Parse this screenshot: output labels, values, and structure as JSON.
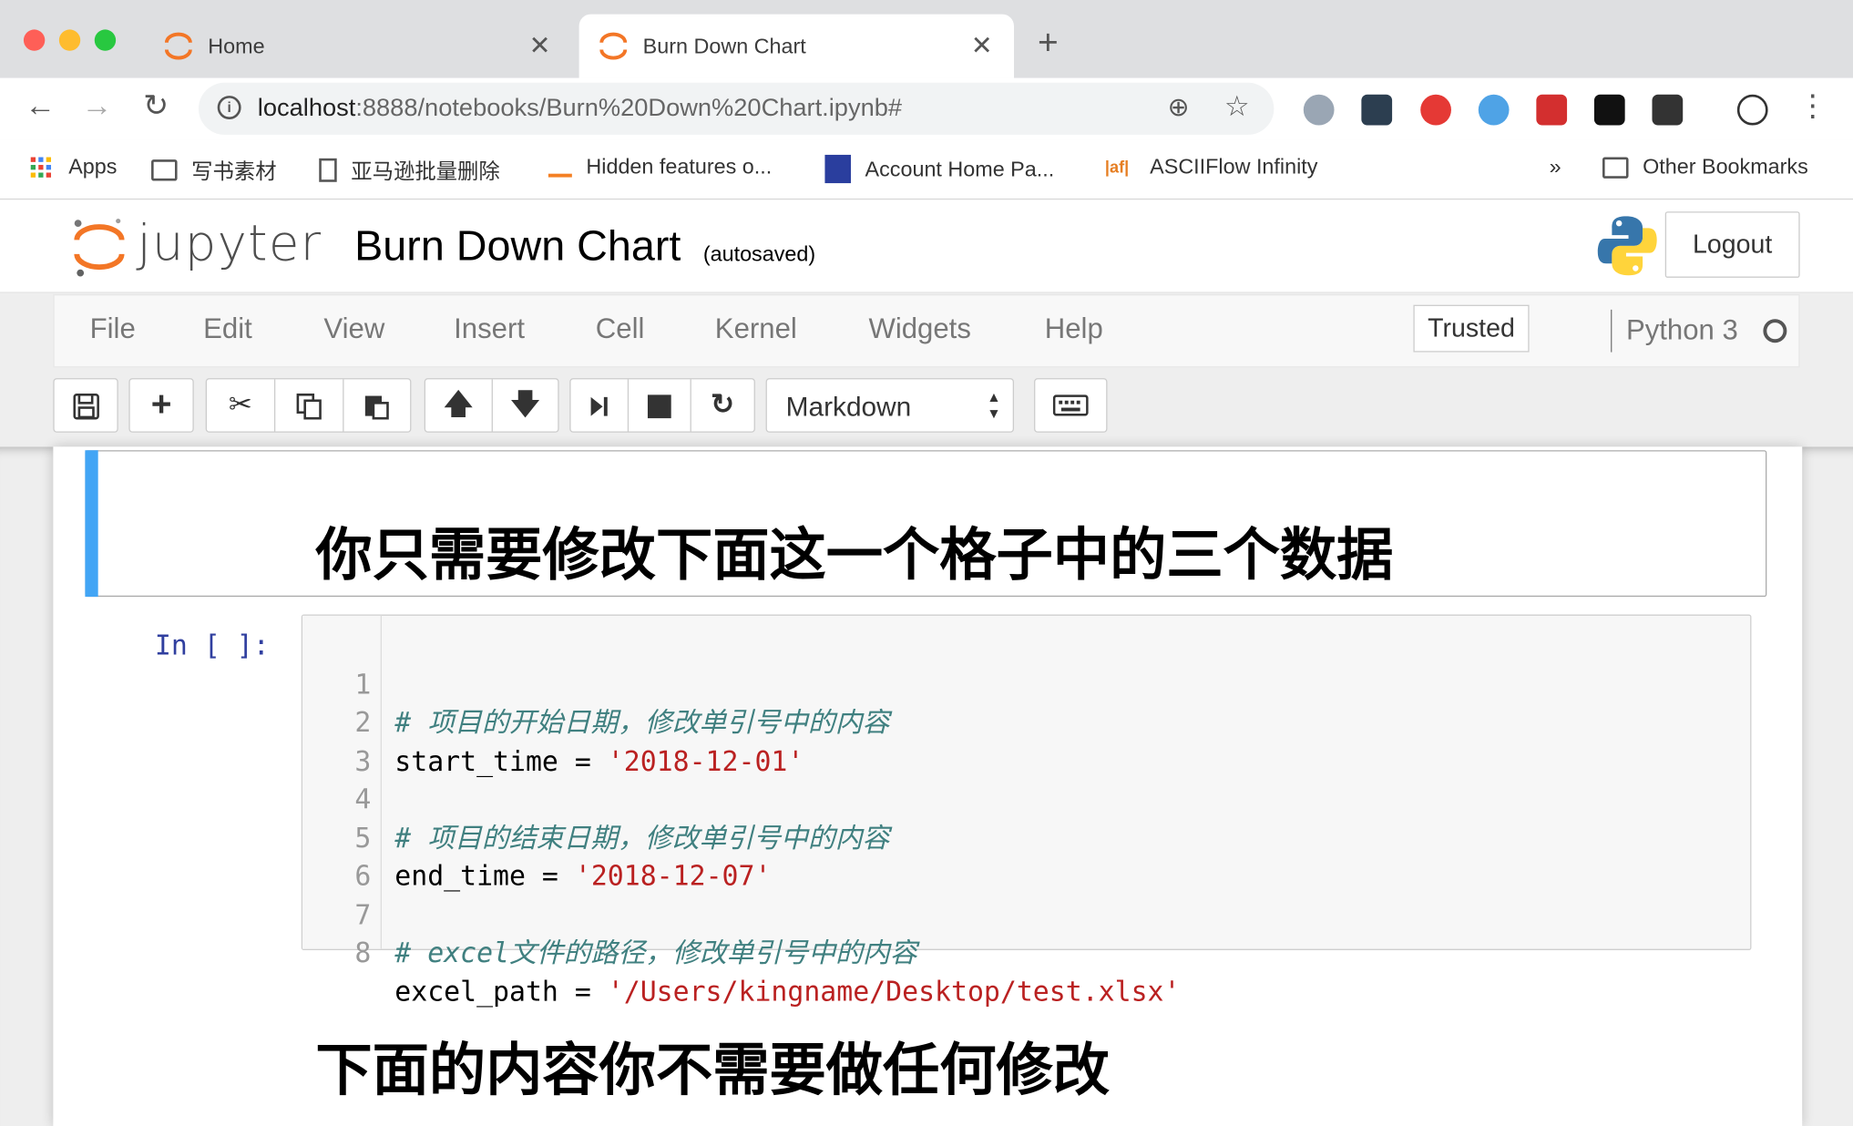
{
  "browser": {
    "tabs": [
      {
        "title": "Home",
        "active": false
      },
      {
        "title": "Burn Down Chart",
        "active": true
      }
    ],
    "address": {
      "host": "localhost",
      "path": ":8888/notebooks/Burn%20Down%20Chart.ipynb#"
    },
    "bookmarks": [
      {
        "label": "Apps",
        "icon": "apps-grid-icon"
      },
      {
        "label": "写书素材",
        "icon": "folder-icon"
      },
      {
        "label": "亚马逊批量删除",
        "icon": "page-icon"
      },
      {
        "label": "Hidden features o...",
        "icon": "stackoverflow-icon"
      },
      {
        "label": "Account Home Pa...",
        "icon": "account-icon"
      },
      {
        "label": "ASCIIFlow Infinity",
        "icon": "asciiflow-icon"
      },
      {
        "label": "»",
        "icon": "overflow-chevron"
      },
      {
        "label": "Other Bookmarks",
        "icon": "folder-icon"
      }
    ],
    "colors": {
      "tab_strip": "#dedfe1",
      "close_red": "#fe5f57",
      "minimize_yellow": "#febc2e",
      "zoom_green": "#28c840"
    }
  },
  "jupyter": {
    "logo_text": "jupyter",
    "notebook_title": "Burn Down Chart",
    "autosave_status": "(autosaved)",
    "logout_label": "Logout",
    "menu": [
      "File",
      "Edit",
      "View",
      "Insert",
      "Cell",
      "Kernel",
      "Widgets",
      "Help"
    ],
    "trusted_label": "Trusted",
    "kernel_name": "Python 3",
    "cell_type": "Markdown",
    "accent_color": "#42a5f5"
  },
  "cells": {
    "heading1": "你只需要修改下面这一个格子中的三个数据",
    "prompt": "In [ ]:",
    "code_lines": [
      {
        "num": "1",
        "comment": "# 项目的开始日期，修改单引号中的内容",
        "code": "",
        "string": ""
      },
      {
        "num": "2",
        "comment": "",
        "code": "start_time = ",
        "string": "'2018-12-01'"
      },
      {
        "num": "3",
        "comment": "",
        "code": "",
        "string": ""
      },
      {
        "num": "4",
        "comment": "# 项目的结束日期，修改单引号中的内容",
        "code": "",
        "string": ""
      },
      {
        "num": "5",
        "comment": "",
        "code": "end_time = ",
        "string": "'2018-12-07'"
      },
      {
        "num": "6",
        "comment": "",
        "code": "",
        "string": ""
      },
      {
        "num": "7",
        "comment": "# excel文件的路径，修改单引号中的内容",
        "code": "",
        "string": ""
      },
      {
        "num": "8",
        "comment": "",
        "code": "excel_path = ",
        "string": "'/Users/kingname/Desktop/test.xlsx'"
      }
    ],
    "heading2": "下面的内容你不需要做任何修改"
  }
}
